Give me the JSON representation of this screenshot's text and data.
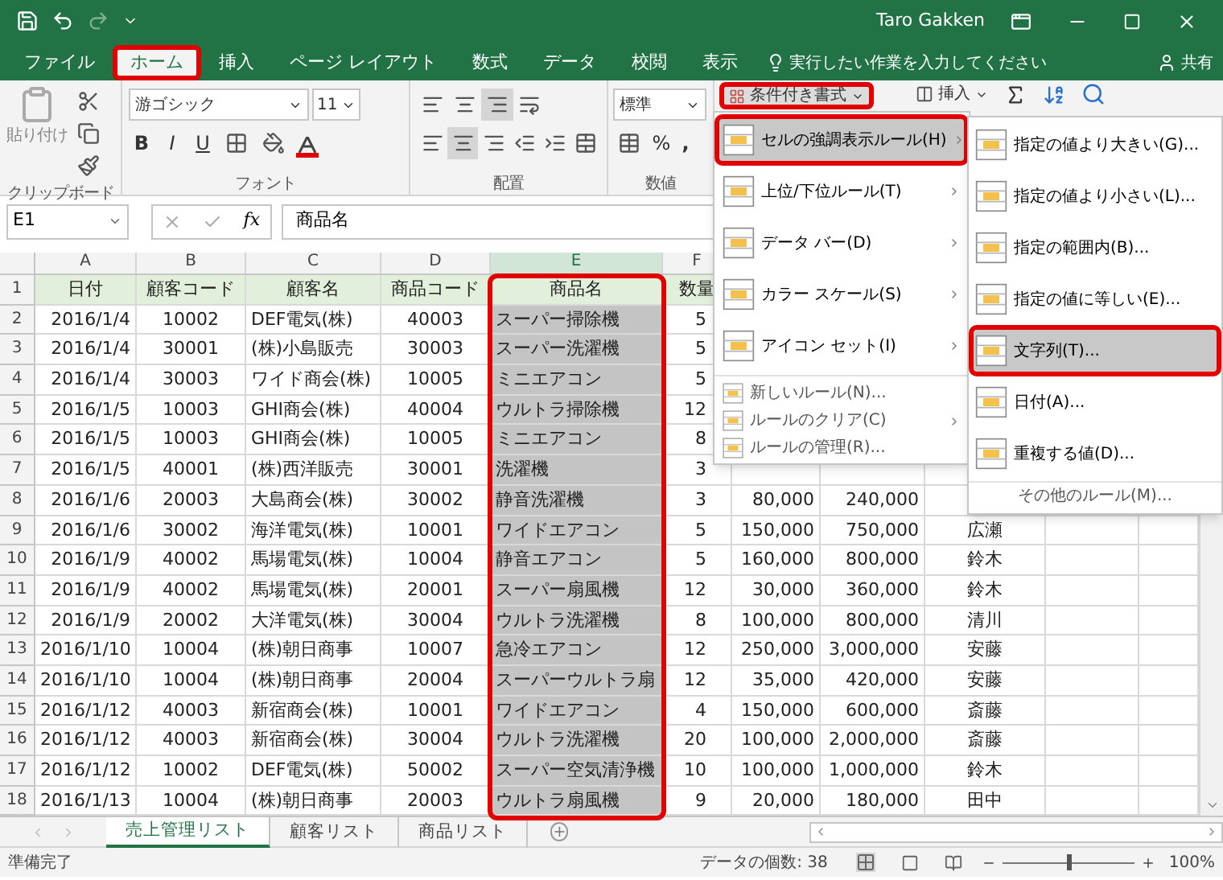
{
  "window": {
    "title": "Taro Gakken"
  },
  "tabs": [
    {
      "label": "ファイル",
      "selected": false,
      "highlighted": false
    },
    {
      "label": "ホーム",
      "selected": true,
      "highlighted": true
    },
    {
      "label": "挿入",
      "selected": false,
      "highlighted": false
    },
    {
      "label": "ページ レイアウト",
      "selected": false,
      "highlighted": false
    },
    {
      "label": "数式",
      "selected": false,
      "highlighted": false
    },
    {
      "label": "データ",
      "selected": false,
      "highlighted": false
    },
    {
      "label": "校閲",
      "selected": false,
      "highlighted": false
    },
    {
      "label": "表示",
      "selected": false,
      "highlighted": false
    }
  ],
  "tell_me": {
    "placeholder": "実行したい作業を入力してください"
  },
  "share": "共有",
  "ribbon": {
    "paste": "貼り付け",
    "font_name": "游ゴシック",
    "font_size": "11",
    "format_buttons": [
      "B",
      "I",
      "U"
    ],
    "number_format": "標準",
    "percent": "%",
    "comma": ",",
    "conditional_format": {
      "label": "条件付き書式",
      "highlighted": true
    },
    "insert": "挿入",
    "groups": [
      "クリップボード",
      "フォント",
      "配置",
      "数値"
    ]
  },
  "formula_bar": {
    "name_box": "E1",
    "fx": "fx",
    "value": "商品名"
  },
  "grid": {
    "columns": [
      {
        "letter": "A",
        "selected": false,
        "highlighted": false
      },
      {
        "letter": "B",
        "selected": false,
        "highlighted": false
      },
      {
        "letter": "C",
        "selected": false,
        "highlighted": false
      },
      {
        "letter": "D",
        "selected": false,
        "highlighted": false
      },
      {
        "letter": "E",
        "selected": true,
        "highlighted": true
      },
      {
        "letter": "F",
        "selected": false,
        "highlighted": false
      }
    ],
    "rows": [
      {
        "number": "1",
        "kind": "header",
        "cells": [
          "日付",
          "顧客コード",
          "顧客名",
          "商品コード",
          "商品名",
          "数量"
        ]
      },
      {
        "number": "2",
        "kind": "data",
        "cells": [
          "2016/1/4",
          "10002",
          "DEF電気(株)",
          "40003",
          "スーパー掃除機",
          "5"
        ]
      },
      {
        "number": "3",
        "kind": "data",
        "cells": [
          "2016/1/4",
          "30001",
          "(株)小島販売",
          "30003",
          "スーパー洗濯機",
          "5"
        ]
      },
      {
        "number": "4",
        "kind": "data",
        "cells": [
          "2016/1/4",
          "30003",
          "ワイド商会(株)",
          "10005",
          "ミニエアコン",
          "5"
        ]
      },
      {
        "number": "5",
        "kind": "data",
        "cells": [
          "2016/1/5",
          "10003",
          "GHI商会(株)",
          "40004",
          "ウルトラ掃除機",
          "12"
        ]
      },
      {
        "number": "6",
        "kind": "data",
        "cells": [
          "2016/1/5",
          "10003",
          "GHI商会(株)",
          "10005",
          "ミニエアコン",
          "8"
        ]
      },
      {
        "number": "7",
        "kind": "data",
        "cells": [
          "2016/1/5",
          "40001",
          "(株)西洋販売",
          "30001",
          "洗濯機",
          "3"
        ]
      },
      {
        "number": "8",
        "kind": "data",
        "cells": [
          "2016/1/6",
          "20003",
          "大島商会(株)",
          "30002",
          "静音洗濯機",
          "3",
          "80,000",
          "240,000"
        ]
      },
      {
        "number": "9",
        "kind": "data",
        "cells": [
          "2016/1/6",
          "30002",
          "海洋電気(株)",
          "10001",
          "ワイドエアコン",
          "5",
          "150,000",
          "750,000",
          "広瀬"
        ]
      },
      {
        "number": "10",
        "kind": "data",
        "cells": [
          "2016/1/9",
          "40002",
          "馬場電気(株)",
          "10004",
          "静音エアコン",
          "5",
          "160,000",
          "800,000",
          "鈴木"
        ]
      },
      {
        "number": "11",
        "kind": "data",
        "cells": [
          "2016/1/9",
          "40002",
          "馬場電気(株)",
          "20001",
          "スーパー扇風機",
          "12",
          "30,000",
          "360,000",
          "鈴木"
        ]
      },
      {
        "number": "12",
        "kind": "data",
        "cells": [
          "2016/1/9",
          "20002",
          "大洋電気(株)",
          "30004",
          "ウルトラ洗濯機",
          "8",
          "100,000",
          "800,000",
          "清川"
        ]
      },
      {
        "number": "13",
        "kind": "data",
        "cells": [
          "2016/1/10",
          "10004",
          "(株)朝日商事",
          "10007",
          "急冷エアコン",
          "12",
          "250,000",
          "3,000,000",
          "安藤"
        ]
      },
      {
        "number": "14",
        "kind": "data",
        "cells": [
          "2016/1/10",
          "10004",
          "(株)朝日商事",
          "20004",
          "スーパーウルトラ扇",
          "12",
          "35,000",
          "420,000",
          "安藤"
        ]
      },
      {
        "number": "15",
        "kind": "data",
        "cells": [
          "2016/1/12",
          "40003",
          "新宿商会(株)",
          "10001",
          "ワイドエアコン",
          "4",
          "150,000",
          "600,000",
          "斎藤"
        ]
      },
      {
        "number": "16",
        "kind": "data",
        "cells": [
          "2016/1/12",
          "40003",
          "新宿商会(株)",
          "30004",
          "ウルトラ洗濯機",
          "20",
          "100,000",
          "2,000,000",
          "斎藤"
        ]
      },
      {
        "number": "17",
        "kind": "data",
        "cells": [
          "2016/1/12",
          "10002",
          "DEF電気(株)",
          "50002",
          "スーパー空気清浄機",
          "10",
          "100,000",
          "1,000,000",
          "鈴木"
        ]
      },
      {
        "number": "18",
        "kind": "data",
        "cells": [
          "2016/1/13",
          "10004",
          "(株)朝日商事",
          "20003",
          "ウルトラ扇風機",
          "9",
          "20,000",
          "180,000",
          "田中"
        ]
      }
    ]
  },
  "sheet_tabs": [
    {
      "label": "売上管理リスト",
      "selected": true
    },
    {
      "label": "顧客リスト",
      "selected": false
    },
    {
      "label": "商品リスト",
      "selected": false
    }
  ],
  "status_bar": {
    "status": "準備完了",
    "count": "データの個数: 38",
    "zoom_slider": {
      "level": 0.5
    },
    "zoom": "100%"
  },
  "menu": {
    "items": [
      {
        "label": "セルの強調表示ルール(H)",
        "kind": "large",
        "selected": true,
        "highlighted": true,
        "has_submenu": true
      },
      {
        "label": "上位/下位ルール(T)",
        "kind": "large",
        "selected": false,
        "highlighted": false,
        "has_submenu": true
      },
      {
        "label": "データ バー(D)",
        "kind": "large",
        "selected": false,
        "highlighted": false,
        "has_submenu": true
      },
      {
        "label": "カラー スケール(S)",
        "kind": "large",
        "selected": false,
        "highlighted": false,
        "has_submenu": true
      },
      {
        "label": "アイコン セット(I)",
        "kind": "large",
        "selected": false,
        "highlighted": false,
        "has_submenu": true
      },
      {
        "label": "新しいルール(N)...",
        "kind": "small",
        "selected": false,
        "highlighted": false,
        "has_submenu": false
      },
      {
        "label": "ルールのクリア(C)",
        "kind": "small",
        "selected": false,
        "highlighted": false,
        "has_submenu": true
      },
      {
        "label": "ルールの管理(R)...",
        "kind": "small",
        "selected": false,
        "highlighted": false,
        "has_submenu": false
      }
    ]
  },
  "submenu": {
    "items": [
      {
        "label": "指定の値より大きい(G)...",
        "kind": "large",
        "selected": false,
        "highlighted": false
      },
      {
        "label": "指定の値より小さい(L)...",
        "kind": "large",
        "selected": false,
        "highlighted": false
      },
      {
        "label": "指定の範囲内(B)...",
        "kind": "large",
        "selected": false,
        "highlighted": false
      },
      {
        "label": "指定の値に等しい(E)...",
        "kind": "large",
        "selected": false,
        "highlighted": false
      },
      {
        "label": "文字列(T)...",
        "kind": "large",
        "selected": true,
        "highlighted": true
      },
      {
        "label": "日付(A)...",
        "kind": "large",
        "selected": false,
        "highlighted": false
      },
      {
        "label": "重複する値(D)...",
        "kind": "large",
        "selected": false,
        "highlighted": false
      },
      {
        "label": "その他のルール(M)...",
        "kind": "footer",
        "selected": false,
        "highlighted": false
      }
    ]
  }
}
